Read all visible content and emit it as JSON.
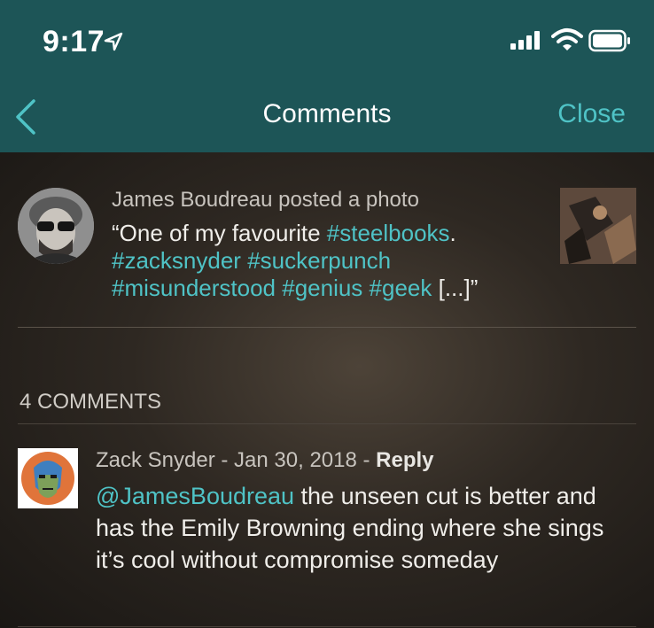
{
  "status_bar": {
    "time": "9:17",
    "icons": [
      "location-arrow-icon",
      "cellular-signal-icon",
      "wifi-icon",
      "battery-icon"
    ]
  },
  "nav": {
    "title": "Comments",
    "close_label": "Close",
    "back_icon": "chevron-left-icon"
  },
  "post": {
    "meta": "James Boudreau posted a photo",
    "text_open": "“One of my favourite ",
    "tag1": "#steelbooks",
    "after_tag1": ".",
    "tag2": "#zacksnyder",
    "tag3": "#suckerpunch",
    "tag4": "#misunderstood",
    "tag5": "#genius",
    "tag6": "#geek",
    "text_close": " [...]”"
  },
  "comments_section": {
    "count_label": "4 COMMENTS"
  },
  "comment": {
    "meta_author_date": "Zack Snyder - Jan 30, 2018 - ",
    "reply_label": "Reply",
    "mention": "@JamesBoudreau",
    "text": " the unseen cut is better and has the Emily Browning ending where she sings it’s cool without compromise someday"
  },
  "colors": {
    "header_bg": "#1d5557",
    "accent": "#4fc3c6",
    "text_primary": "#f0eeea",
    "text_secondary": "#c8c4be"
  }
}
